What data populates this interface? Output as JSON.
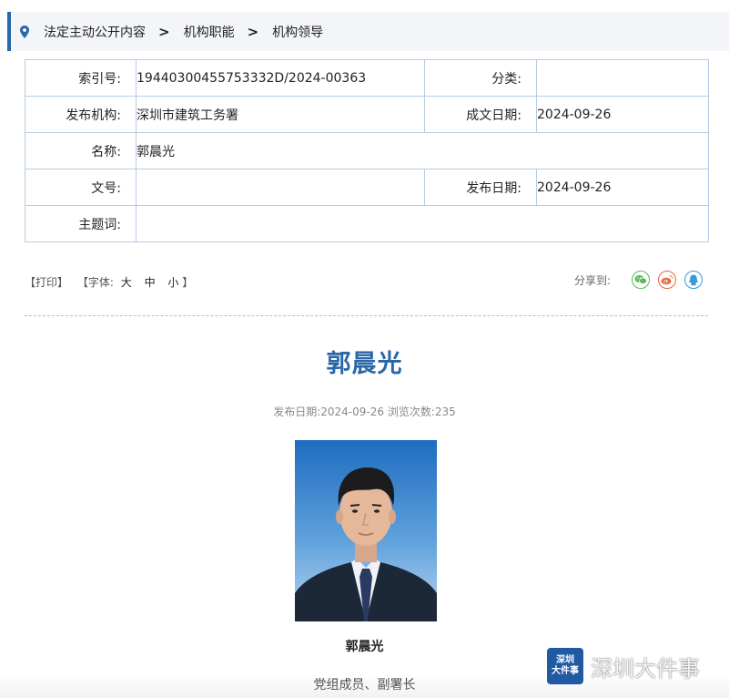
{
  "breadcrumb": {
    "items": [
      "法定主动公开内容",
      "机构职能",
      "机构领导"
    ],
    "separator": ">"
  },
  "meta": {
    "index_label": "索引号:",
    "index_value": "19440300455753332D/2024-00363",
    "category_label": "分类:",
    "category_value": "",
    "issuer_label": "发布机构:",
    "issuer_value": "深圳市建筑工务署",
    "written_date_label": "成文日期:",
    "written_date_value": "2024-09-26",
    "name_label": "名称:",
    "name_value": "郭晨光",
    "doc_no_label": "文号:",
    "doc_no_value": "",
    "publish_date_label": "发布日期:",
    "publish_date_value": "2024-09-26",
    "keywords_label": "主题词:",
    "keywords_value": ""
  },
  "tools": {
    "print": "【打印】",
    "font_prefix": "【字体:",
    "font_large": "大",
    "font_medium": "中",
    "font_small": "小",
    "font_suffix": "】",
    "share_label": "分享到:"
  },
  "article": {
    "title": "郭晨光",
    "info": "发布日期:2024-09-26  浏览次数:235",
    "photo_caption": "郭晨光",
    "role": "党组成员、副署长"
  },
  "watermark": {
    "logo_line1": "深圳",
    "logo_line2": "大件事",
    "text": "深圳大件事"
  },
  "colors": {
    "accent": "#2a67a8",
    "wechat": "#5cb85c",
    "weibo": "#e8643c",
    "qq": "#3a9bd9"
  }
}
